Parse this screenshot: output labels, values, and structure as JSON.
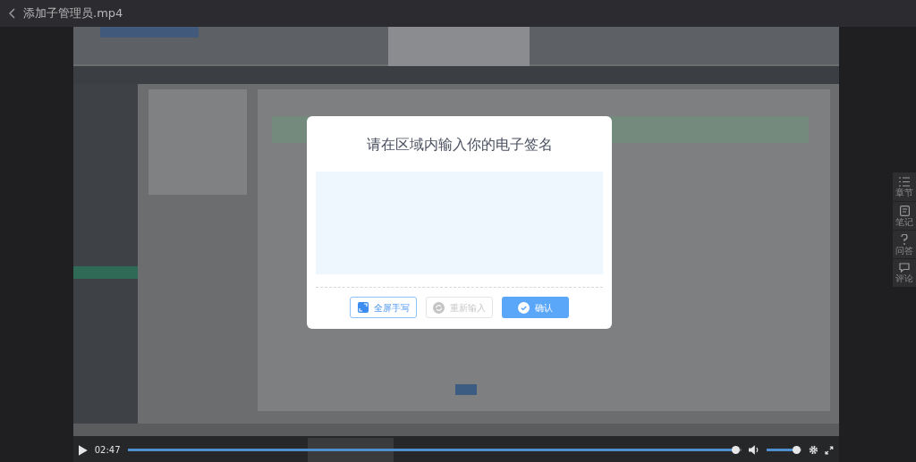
{
  "player": {
    "title": "添加子管理员.mp4"
  },
  "dialog": {
    "title": "请在区域内输入你的电子签名",
    "buttons": [
      {
        "label": "全屏手写",
        "kind": "fullscreen",
        "disabled": false
      },
      {
        "label": "重新输入",
        "kind": "reset",
        "disabled": true
      },
      {
        "label": "确认",
        "kind": "confirm",
        "disabled": false
      }
    ]
  },
  "controls": {
    "time": "02:47",
    "progress": {
      "level": 0.99
    },
    "volume": {
      "level": 0.85
    }
  },
  "side_panel": [
    {
      "label": "章节",
      "kind": "chapters"
    },
    {
      "label": "笔记",
      "kind": "notes"
    },
    {
      "label": "问答",
      "kind": "qa"
    },
    {
      "label": "评论",
      "kind": "comments"
    }
  ]
}
